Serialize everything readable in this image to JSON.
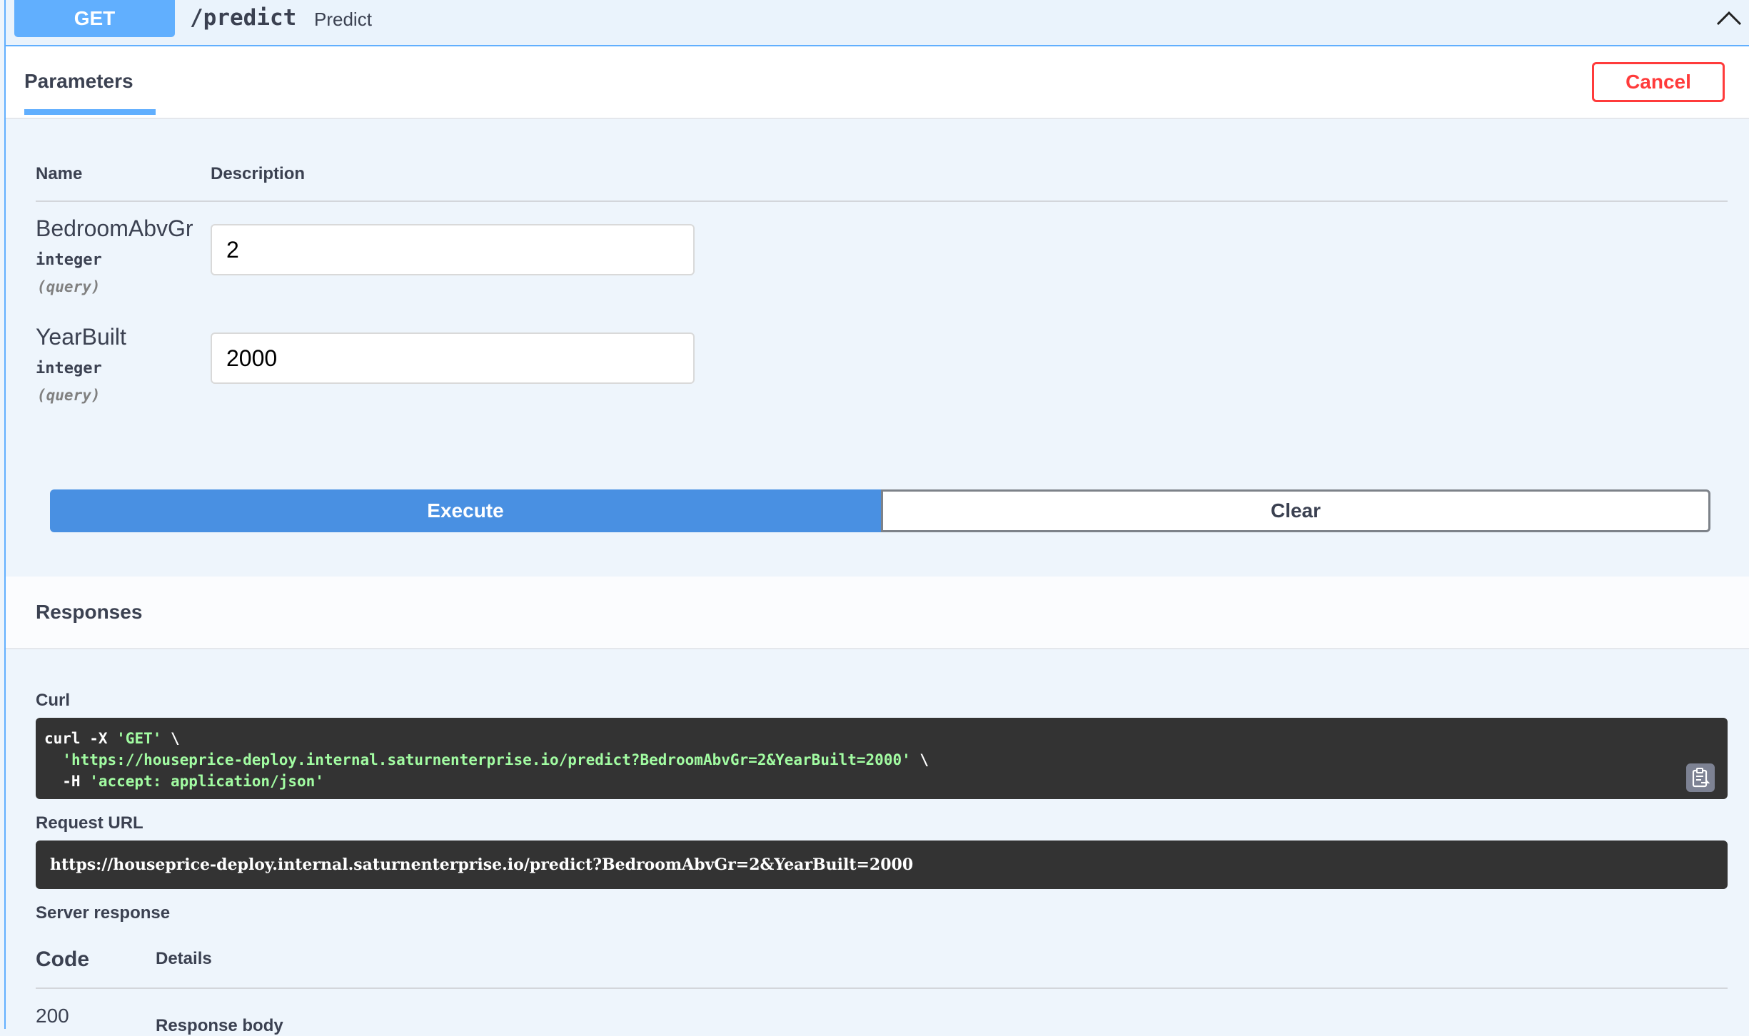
{
  "operation": {
    "method": "GET",
    "path": "/predict",
    "summary": "Predict",
    "collapse_icon": "chevron-up-icon"
  },
  "parameters_section": {
    "tab_label": "Parameters",
    "cancel_label": "Cancel",
    "columns": {
      "name": "Name",
      "description": "Description"
    },
    "params": [
      {
        "name": "BedroomAbvGr",
        "type": "integer",
        "in": "(query)",
        "value": "2"
      },
      {
        "name": "YearBuilt",
        "type": "integer",
        "in": "(query)",
        "value": "2000"
      }
    ]
  },
  "actions": {
    "execute_label": "Execute",
    "clear_label": "Clear"
  },
  "responses_section": {
    "title": "Responses",
    "curl_label": "Curl",
    "curl": {
      "line1_cmd": "curl -X ",
      "line1_str": "'GET'",
      "line1_end": " \\",
      "line2_indent": "  ",
      "line2_str": "'https://houseprice-deploy.internal.saturnenterprise.io/predict?BedroomAbvGr=2&YearBuilt=2000'",
      "line2_end": " \\",
      "line3_cmd": "  -H ",
      "line3_str": "'accept: application/json'"
    },
    "copy_icon": "clipboard-copy-icon",
    "request_url_label": "Request URL",
    "request_url": "https://houseprice-deploy.internal.saturnenterprise.io/predict?BedroomAbvGr=2&YearBuilt=2000",
    "server_response_label": "Server response",
    "columns": {
      "code": "Code",
      "details": "Details"
    },
    "response_code": "200",
    "response_body_label": "Response body"
  },
  "colors": {
    "get_blue": "#61affe",
    "execute_blue": "#4990e2",
    "cancel_red": "#ff3b3b",
    "code_bg": "#333333",
    "code_string": "#a2fca2"
  }
}
